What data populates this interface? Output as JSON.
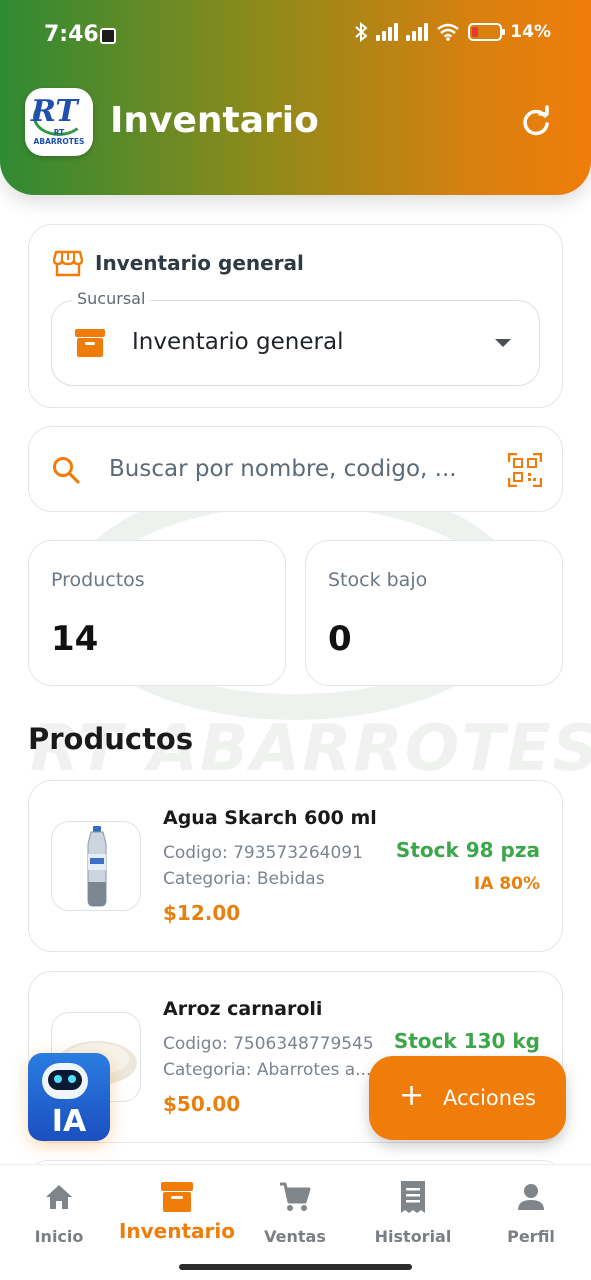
{
  "status_bar": {
    "time": "7:46",
    "battery": "14%"
  },
  "header": {
    "title": "Inventario",
    "logo_text": "RT ABARROTES"
  },
  "branch": {
    "heading": "Inventario general",
    "field_label": "Sucursal",
    "selected": "Inventario general"
  },
  "search": {
    "placeholder": "Buscar por nombre, codigo, ..."
  },
  "stats": {
    "products_label": "Productos",
    "products_value": "14",
    "low_stock_label": "Stock bajo",
    "low_stock_value": "0"
  },
  "section_title": "Productos",
  "products": [
    {
      "name": "Agua Skarch 600 ml",
      "code": "Codigo: 793573264091",
      "category": "Categoria: Bebidas",
      "price": "$12.00",
      "stock": "Stock 98 pza",
      "ia": "IA 80%"
    },
    {
      "name": "Arroz carnaroli",
      "code": "Codigo: 7506348779545",
      "category": "Categoria: Abarrotes a...",
      "price": "$50.00",
      "stock": "Stock 130 kg",
      "ia": ""
    }
  ],
  "ai_button": {
    "label": "IA"
  },
  "actions_button": {
    "label": "Acciones"
  },
  "nav": {
    "items": [
      {
        "label": "Inicio",
        "icon": "home-icon"
      },
      {
        "label": "Inventario",
        "icon": "box-icon"
      },
      {
        "label": "Ventas",
        "icon": "cart-icon"
      },
      {
        "label": "Historial",
        "icon": "receipt-icon"
      },
      {
        "label": "Perfil",
        "icon": "person-icon"
      }
    ],
    "active": "Inventario"
  },
  "colors": {
    "accent": "#f07d0a",
    "green": "#3ea64a",
    "header_start": "#2f8a34",
    "header_end": "#f07d0a"
  }
}
